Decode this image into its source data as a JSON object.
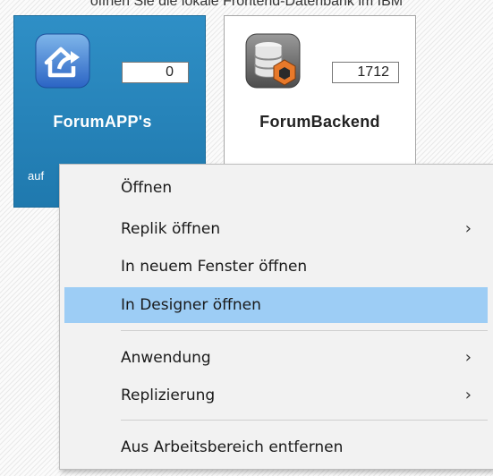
{
  "caption": "öffnen Sie die lokale Frontend-Datenbank im IBM",
  "tiles": [
    {
      "title": "ForumAPP's",
      "count": "0",
      "subtitle": "auf",
      "icon": "house-arrow-icon",
      "background": "#2a86bd"
    },
    {
      "title": "ForumBackend",
      "count": "1712",
      "icon": "database-icon",
      "background": "#ffffff"
    }
  ],
  "context_menu": {
    "items": [
      {
        "label": "Öffnen"
      },
      {
        "label": "Replik öffnen",
        "submenu_arrow": "›"
      },
      {
        "label": "In neuem Fenster öffnen"
      },
      {
        "label": "In Designer öffnen",
        "highlighted": true
      },
      {
        "label": "Anwendung",
        "submenu_arrow": "›"
      },
      {
        "label": "Replizierung",
        "submenu_arrow": "›"
      },
      {
        "label": "Aus Arbeitsbereich entfernen"
      }
    ],
    "highlight_color": "#9dcdf5"
  }
}
